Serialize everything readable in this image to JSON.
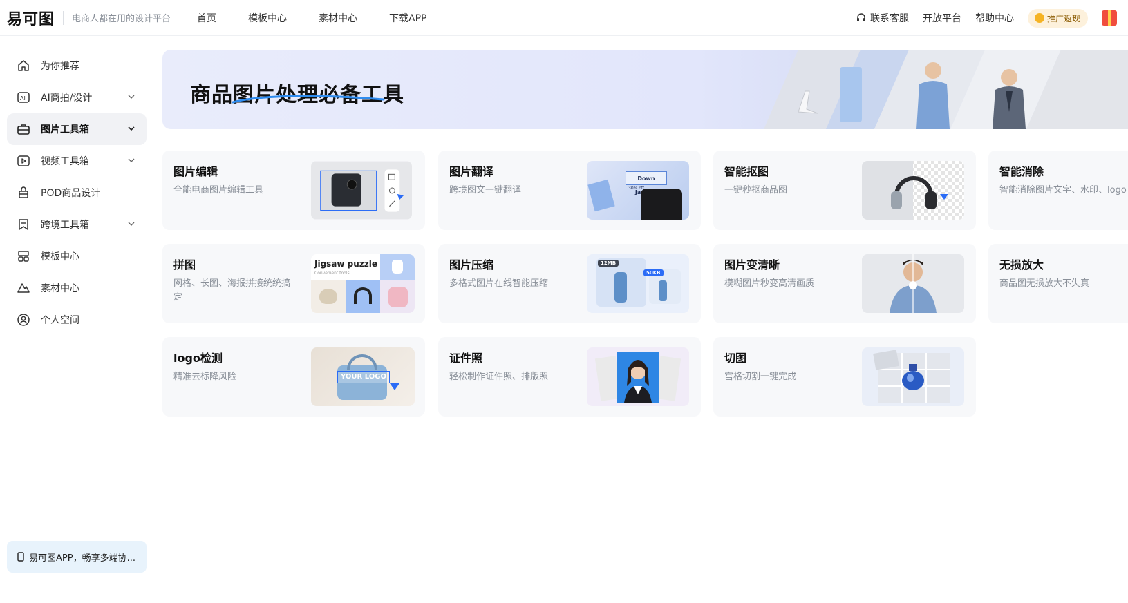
{
  "header": {
    "logo": "易可图",
    "slogan": "电商人都在用的设计平台",
    "nav": [
      "首页",
      "模板中心",
      "素材中心",
      "下载APP"
    ],
    "contact": "联系客服",
    "open_platform": "开放平台",
    "help": "帮助中心",
    "promo": "推广返现"
  },
  "sidebar": {
    "items": [
      {
        "label": "为你推荐",
        "icon": "home-icon"
      },
      {
        "label": "AI商拍/设计",
        "icon": "ai-icon"
      },
      {
        "label": "图片工具箱",
        "icon": "toolbox-icon"
      },
      {
        "label": "视频工具箱",
        "icon": "video-icon"
      },
      {
        "label": "POD商品设计",
        "icon": "bag-icon"
      },
      {
        "label": "跨境工具箱",
        "icon": "bookmark-icon"
      },
      {
        "label": "模板中心",
        "icon": "template-icon"
      },
      {
        "label": "素材中心",
        "icon": "material-icon"
      },
      {
        "label": "个人空间",
        "icon": "user-icon"
      }
    ],
    "app_promo": "易可图APP，畅享多端协..."
  },
  "banner": {
    "title": "商品图片处理必备工具"
  },
  "tools": [
    {
      "title": "图片编辑",
      "desc": "全能电商图片编辑工具"
    },
    {
      "title": "图片翻译",
      "desc": "跨境图文一键翻译",
      "thumb_text": "Down Jackets",
      "thumb_sub": "30% off"
    },
    {
      "title": "智能抠图",
      "desc": "一键秒抠商品图"
    },
    {
      "title": "智能消除",
      "desc": "智能消除图片文字、水印、logo"
    },
    {
      "title": "拼图",
      "desc": "网格、长图、海报拼接统统搞定",
      "thumb_text": "Jigsaw puzzle",
      "thumb_sub": "Convenient tools"
    },
    {
      "title": "图片压缩",
      "desc": "多格式图片在线智能压缩",
      "thumb_text": "12MB",
      "thumb_sub": "50KB"
    },
    {
      "title": "图片变清晰",
      "desc": "模糊图片秒变高清画质"
    },
    {
      "title": "无损放大",
      "desc": "商品图无损放大不失真"
    },
    {
      "title": "logo检测",
      "desc": "精准去标降风险",
      "thumb_text": "YOUR LOGO"
    },
    {
      "title": "证件照",
      "desc": "轻松制作证件照、排版照"
    },
    {
      "title": "切图",
      "desc": "宫格切割一键完成"
    }
  ],
  "colors": {
    "accent": "#2b6cf6",
    "active_bg": "#f1f2f5",
    "card_bg": "#f7f8fa"
  }
}
